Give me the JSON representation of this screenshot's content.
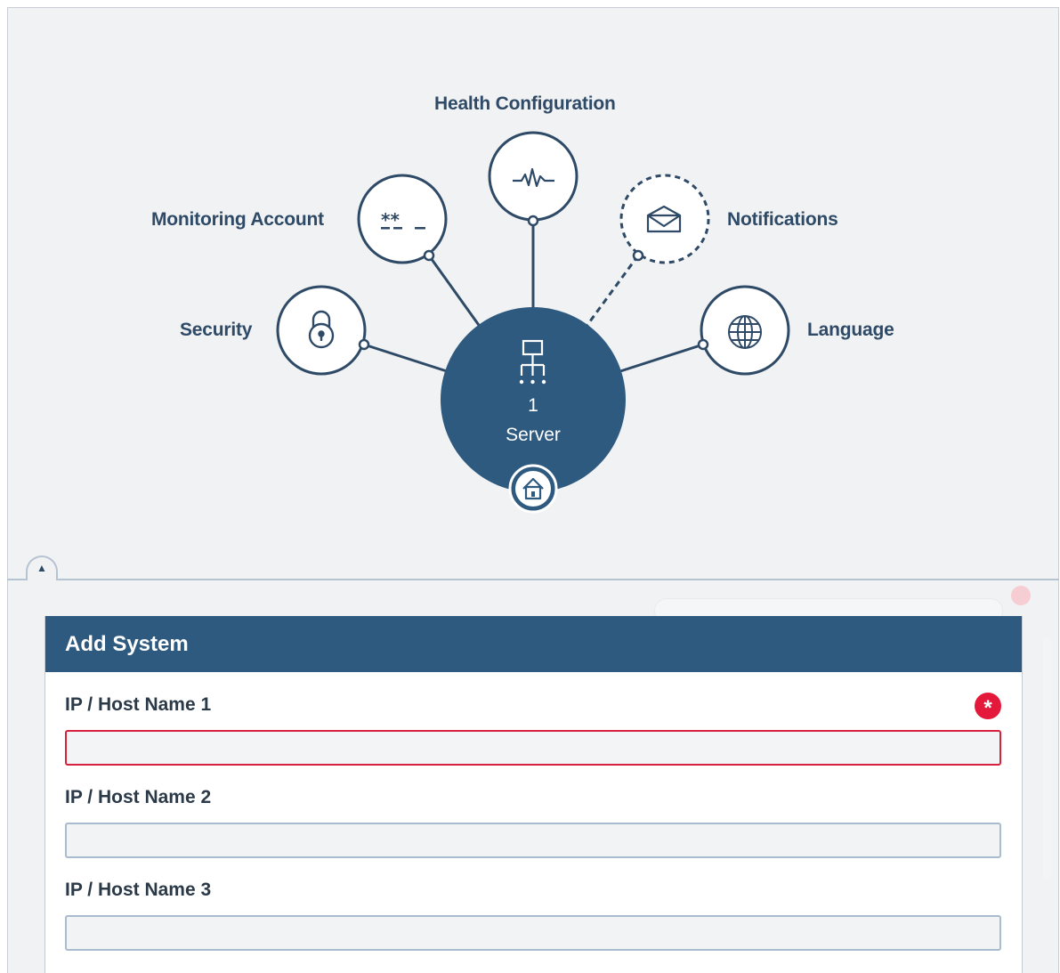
{
  "diagram": {
    "nodes": {
      "health": {
        "label": "Health Configuration",
        "icon": "pulse-icon",
        "style": "solid"
      },
      "monitoring": {
        "label": "Monitoring Account",
        "icon": "password-icon",
        "style": "solid"
      },
      "notifications": {
        "label": "Notifications",
        "icon": "envelope-icon",
        "style": "dashed"
      },
      "security": {
        "label": "Security",
        "icon": "lock-icon",
        "style": "solid"
      },
      "language": {
        "label": "Language",
        "icon": "globe-icon",
        "style": "solid"
      }
    },
    "server": {
      "count": "1",
      "label": "Server",
      "icon": "network-icon",
      "badge_icon": "home-icon"
    }
  },
  "panel": {
    "title": "Add System",
    "fields": [
      {
        "label": "IP / Host Name 1",
        "value": "",
        "required": true
      },
      {
        "label": "IP / Host Name 2",
        "value": "",
        "required": false
      },
      {
        "label": "IP / Host Name 3",
        "value": "",
        "required": false
      }
    ],
    "required_marker": "*"
  },
  "colors": {
    "primary": "#2f5a7f",
    "node_stroke": "#2e4a66",
    "error": "#e3183a",
    "background": "#f1f2f4"
  }
}
